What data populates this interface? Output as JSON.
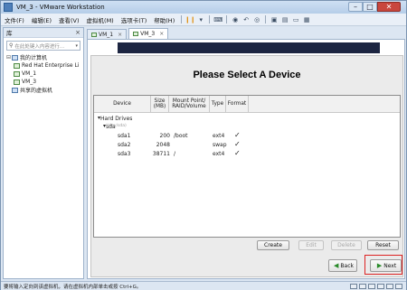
{
  "window": {
    "title": "VM_3 - VMware Workstation",
    "min": "–",
    "max": "□",
    "close": "✕"
  },
  "menubar": [
    "文件(F)",
    "编辑(E)",
    "查看(V)",
    "虚拟机(M)",
    "选项卡(T)",
    "帮助(H)"
  ],
  "toolbar_icons": [
    "pause-icon",
    "send-ctrl-alt-del-icon",
    "snapshot-icon",
    "revert-snapshot-icon",
    "manage-snapshots-icon",
    "fullscreen-icon",
    "unity-icon",
    "console-view-icon",
    "thumbnail-icon"
  ],
  "library": {
    "title": "库",
    "close": "×",
    "search_placeholder": "在此处键入内容进行...",
    "tree": [
      {
        "label": "我的计算机",
        "level": 0,
        "expanded": true
      },
      {
        "label": "Red Hat Enterprise Li",
        "level": 1
      },
      {
        "label": "VM_1",
        "level": 1
      },
      {
        "label": "VM_3",
        "level": 1
      },
      {
        "label": "共享的虚拟机",
        "level": 0
      }
    ]
  },
  "tabs": [
    {
      "label": "VM_1",
      "close": "×",
      "active": false
    },
    {
      "label": "VM_3",
      "close": "×",
      "active": true
    }
  ],
  "installer": {
    "heading": "Please Select A Device",
    "columns": {
      "device": "Device",
      "size": "Size\n(MB)",
      "mount": "Mount Point/\nRAID/Volume",
      "type": "Type",
      "format": "Format"
    },
    "group": "Hard Drives",
    "disk": {
      "name": "sda",
      "subtitle": "(/dev/sda)"
    },
    "partitions": [
      {
        "device": "sda1",
        "size": "200",
        "mount": "/boot",
        "type": "ext4",
        "format": "✓"
      },
      {
        "device": "sda2",
        "size": "2048",
        "mount": "",
        "type": "swap",
        "format": "✓"
      },
      {
        "device": "sda3",
        "size": "38711",
        "mount": "/",
        "type": "ext4",
        "format": "✓"
      }
    ],
    "buttons": {
      "create": "Create",
      "edit": "Edit",
      "delete": "Delete",
      "reset": "Reset",
      "back": "Back",
      "next": "Next"
    }
  },
  "statusbar": {
    "text": "要将输入定向到该虚拟机，请在虚拟机内部单击或按 Ctrl+G。"
  },
  "colors": {
    "banner": "#1c2541",
    "highlight": "#dd2222",
    "accent": "#2a8b2a"
  }
}
